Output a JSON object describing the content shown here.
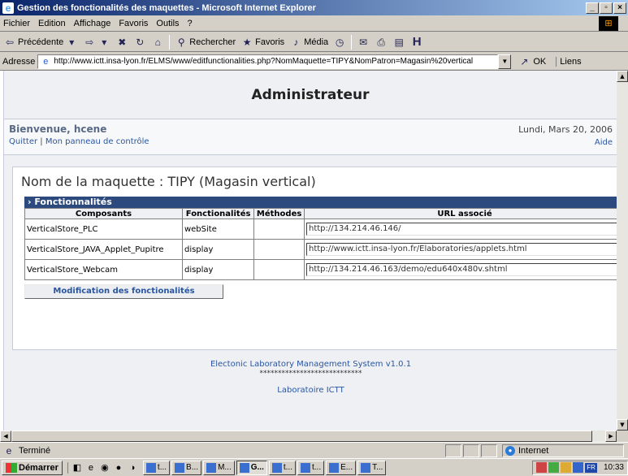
{
  "window": {
    "title": "Gestion des fonctionalités des maquettes - Microsoft Internet Explorer",
    "buttons": [
      "_",
      "▫",
      "×"
    ]
  },
  "menu": [
    "Fichier",
    "Edition",
    "Affichage",
    "Favoris",
    "Outils",
    "?"
  ],
  "toolbar": {
    "back": "Précédente",
    "search": "Rechercher",
    "favorites": "Favoris",
    "media": "Média"
  },
  "address": {
    "label": "Adresse",
    "url": "http://www.ictt.insa-lyon.fr/ELMS/www/editfunctionalities.php?NomMaquette=TIPY&NomPatron=Magasin%20vertical",
    "go": "OK",
    "links": "Liens"
  },
  "page": {
    "header": "Administrateur",
    "welcome": "Bienvenue, hcene",
    "quit": "Quitter",
    "separator": "|",
    "panel": "Mon panneau de contrôle",
    "date": "Lundi, Mars 20, 2006",
    "help": "Aide",
    "heading": "Nom de la maquette : TIPY (Magasin vertical)",
    "section_title": "› Fonctionnalités",
    "columns": [
      "Composants",
      "Fonctionalités",
      "Méthodes",
      "URL associé"
    ],
    "rows": [
      {
        "component": "VerticalStore_PLC",
        "function": "webSite",
        "method": "",
        "url": "http://134.214.46.146/"
      },
      {
        "component": "VerticalStore_JAVA_Applet_Pupitre",
        "function": "display",
        "method": "",
        "url": "http://www.ictt.insa-lyon.fr/Elaboratories/applets.html"
      },
      {
        "component": "VerticalStore_Webcam",
        "function": "display",
        "method": "",
        "url": "http://134.214.46.163/demo/edu640x480v.shtml"
      }
    ],
    "modify_button": "Modification des fonctionalités",
    "footer_title": "Electonic Laboratory Management System v1.0.1",
    "footer_stars": "****************************",
    "footer_lab": "Laboratoire ICTT"
  },
  "status": {
    "text": "Terminé",
    "zone": "Internet"
  },
  "taskbar": {
    "start": "Démarrer",
    "tasks": [
      "t...",
      "B...",
      "M...",
      "G...",
      "t...",
      "t...",
      "E...",
      "T..."
    ],
    "active_index": 3,
    "lang": "FR",
    "clock": "10:33"
  }
}
